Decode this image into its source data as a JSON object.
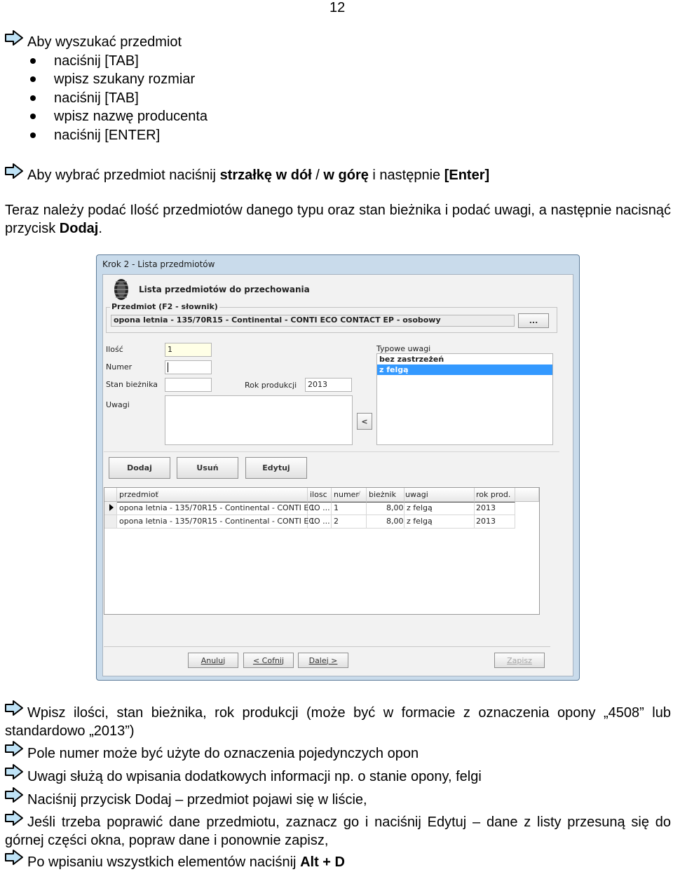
{
  "page_number": "12",
  "section1": {
    "title": "Aby wyszukać przedmiot",
    "bullets": [
      "naciśnij [TAB]",
      "wpisz szukany rozmiar",
      "naciśnij [TAB]",
      "wpisz nazwę producenta",
      "naciśnij [ENTER]"
    ]
  },
  "section2": {
    "pre": "Aby wybrać przedmiot naciśnij ",
    "bold1": "strzałkę w dół",
    "mid": " / ",
    "bold2": "w górę",
    "post": " i następnie ",
    "bold3": "[Enter]"
  },
  "intro": {
    "text": "Teraz należy podać Ilość przedmiotów danego typu oraz stan bieżnika i podać uwagi, a następnie nacisnąć przycisk ",
    "bold": "Dodaj",
    "end": "."
  },
  "dialog": {
    "window_title": "Krok 2 - Lista przedmiotów",
    "header": "Lista przedmiotów do przechowania",
    "group_label": "Przedmiot (F2 - słownik)",
    "item_value": "opona letnia - 135/70R15 - Continental - CONTI ECO CONTACT EP - osobowy",
    "browse_button": "...",
    "labels": {
      "ilosc": "Ilość",
      "numer": "Numer",
      "stan": "Stan bieżnika",
      "rok": "Rok produkcji",
      "uwagi": "Uwagi",
      "typowe": "Typowe uwagi"
    },
    "values": {
      "ilosc": "1",
      "numer": "",
      "stan": "",
      "rok": "2013",
      "uwagi": ""
    },
    "typowe_uwagi": [
      "bez zastrzeżeń",
      "z felgą"
    ],
    "typowe_selected": "z felgą",
    "arrow_button": "<",
    "buttons": {
      "dodaj": "Dodaj",
      "usun": "Usuń",
      "edytuj": "Edytuj"
    },
    "columns": [
      "przedmiot",
      "ilosc",
      "numer",
      "bieżnik",
      "uwagi",
      "rok prod."
    ],
    "rows": [
      [
        "opona letnia - 135/70R15 - Continental - CONTI ECO ...",
        "1",
        "1",
        "8,00",
        "z felgą",
        "2013"
      ],
      [
        "opona letnia - 135/70R15 - Continental - CONTI ECO ...",
        "1",
        "2",
        "8,00",
        "z felgą",
        "2013"
      ]
    ],
    "nav": {
      "anuluj": "Anuluj",
      "cofnij": "< Cofnij",
      "dalej": "Dalej >",
      "zapisz": "Zapisz"
    }
  },
  "notes": {
    "n1": "Wpisz ilości, stan bieżnika, rok produkcji (może być w formacie z oznaczenia opony „4508” lub standardowo „2013”)",
    "n2": "Pole numer może być użyte do oznaczenia pojedynczych opon",
    "n3": "Uwagi służą do wpisania dodatkowych informacji np. o stanie opony, felgi",
    "n4": "Naciśnij przycisk Dodaj – przedmiot pojawi się w liście,",
    "n5": "Jeśli trzeba poprawić dane przedmiotu, zaznacz go i naciśnij Edytuj – dane z listy przesuną się do górnej części okna, popraw dane i ponownie zapisz,",
    "n6_pre": "Po wpisaniu wszystkich elementów naciśnij ",
    "n6_bold": "Alt + D"
  },
  "colors": {
    "arrow_fill": "#bfe3f7",
    "selection": "#3399ff",
    "dialog_frame": "#c9dbeb"
  }
}
